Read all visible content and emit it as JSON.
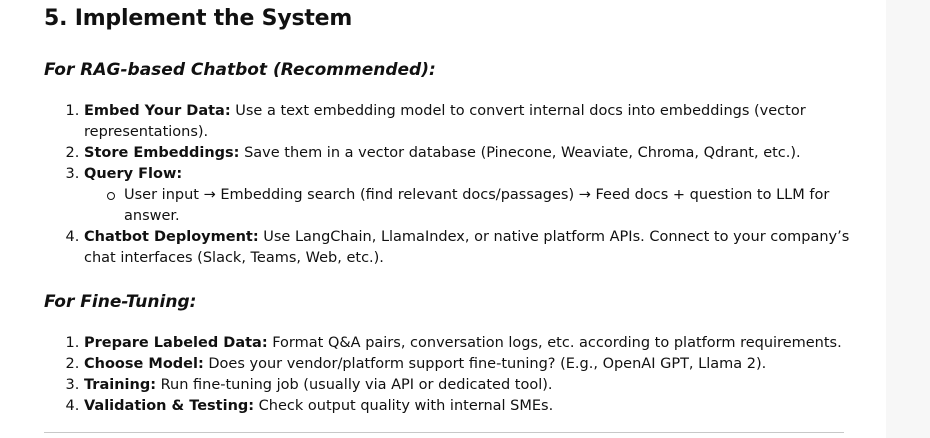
{
  "heading": "5. Implement the System",
  "rag": {
    "title": "For RAG-based Chatbot (Recommended):",
    "items": [
      {
        "label": "Embed Your Data:",
        "text": " Use a text embedding model to convert internal docs into embeddings (vector representations)."
      },
      {
        "label": "Store Embeddings:",
        "text": " Save them in a vector database (Pinecone, Weaviate, Chroma, Qdrant, etc.)."
      },
      {
        "label": "Query Flow:",
        "text": "",
        "sub": "User input → Embedding search (find relevant docs/passages) → Feed docs + question to LLM for answer."
      },
      {
        "label": "Chatbot Deployment:",
        "text": " Use LangChain, LlamaIndex, or native platform APIs. Connect to your company’s chat interfaces (Slack, Teams, Web, etc.)."
      }
    ]
  },
  "finetune": {
    "title": "For Fine-Tuning:",
    "items": [
      {
        "label": "Prepare Labeled Data:",
        "text": " Format Q&A pairs, conversation logs, etc. according to platform requirements."
      },
      {
        "label": "Choose Model:",
        "text": " Does your vendor/platform support fine-tuning? (E.g., OpenAI GPT, Llama 2)."
      },
      {
        "label": "Training:",
        "text": " Run fine-tuning job (usually via API or dedicated tool)."
      },
      {
        "label": "Validation & Testing:",
        "text": " Check output quality with internal SMEs."
      }
    ]
  }
}
